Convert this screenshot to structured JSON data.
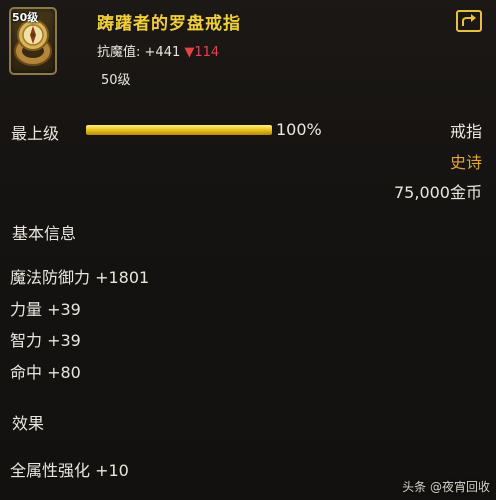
{
  "item": {
    "level_badge": "50级",
    "name": "踌躇者的罗盘戒指",
    "resist_label": "抗魔值:",
    "resist_up": "+441",
    "resist_down": "▼114",
    "level": "50级"
  },
  "upgrade": {
    "label": "最上级",
    "percent_text": "100%",
    "fill_fraction": 1.0
  },
  "meta": {
    "type": "戒指",
    "rarity": "史诗",
    "price": "75,000金币"
  },
  "basic_info": {
    "title": "基本信息",
    "stats": [
      "魔法防御力 +1801",
      "力量 +39",
      "智力 +39",
      "命中 +80"
    ]
  },
  "effects": {
    "title": "效果",
    "items": [
      "全属性强化 +10"
    ]
  },
  "watermark": "头条 @夜宵回收",
  "colors": {
    "name": "#f2cf3a",
    "rarity": "#e5a53a",
    "down_arrow": "#e5434a",
    "bar": "#e9c21c"
  },
  "icons": [
    "compass-ring-icon",
    "share-icon"
  ]
}
